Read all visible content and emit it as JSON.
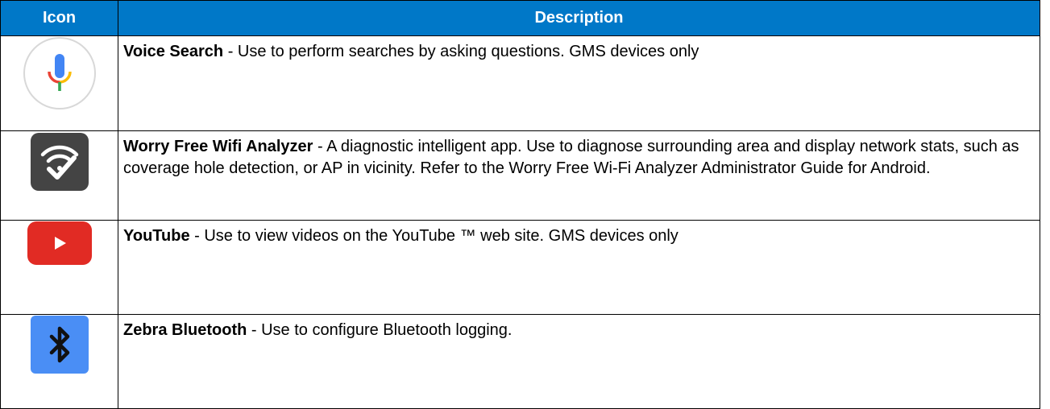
{
  "table": {
    "headers": {
      "icon": "Icon",
      "description": "Description"
    },
    "rows": [
      {
        "icon": "voice-search-icon",
        "name": "Voice Search",
        "description": " - Use to perform searches by asking questions. GMS devices only"
      },
      {
        "icon": "worry-free-wifi-analyzer-icon",
        "name": "Worry Free Wifi Analyzer",
        "description": " - A diagnostic intelligent app. Use to diagnose surrounding area and display network stats, such as coverage hole detection, or AP in vicinity. Refer to the Worry Free Wi-Fi Analyzer Administrator Guide for Android."
      },
      {
        "icon": "youtube-icon",
        "name": "YouTube",
        "description": " - Use to view videos on the YouTube ™ web site. GMS devices only"
      },
      {
        "icon": "zebra-bluetooth-icon",
        "name": "Zebra Bluetooth",
        "description": " - Use to configure Bluetooth logging."
      }
    ]
  },
  "colors": {
    "header_bg": "#0078c8",
    "header_text": "#ffffff",
    "border": "#000000"
  }
}
